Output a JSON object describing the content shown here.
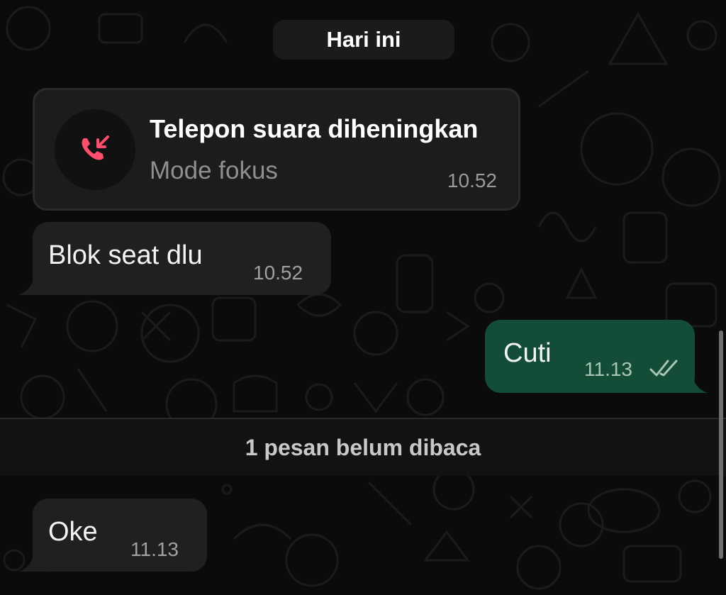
{
  "date_separator": "Hari ini",
  "call_notice": {
    "title": "Telepon suara diheningkan",
    "subtitle": "Mode fokus",
    "time": "10.52",
    "icon": "muted-call-icon",
    "icon_color": "#ff4d6d"
  },
  "messages": [
    {
      "direction": "incoming",
      "text": "Blok seat dlu",
      "time": "10.52"
    },
    {
      "direction": "outgoing",
      "text": "Cuti",
      "time": "11.13",
      "status_icon": "double-check-icon"
    },
    {
      "direction": "incoming",
      "text": "Oke",
      "time": "11.13"
    }
  ],
  "unread_banner": "1 pesan belum dibaca",
  "colors": {
    "background": "#0b0b0b",
    "incoming_bubble": "#202020",
    "outgoing_bubble": "#134d37"
  }
}
